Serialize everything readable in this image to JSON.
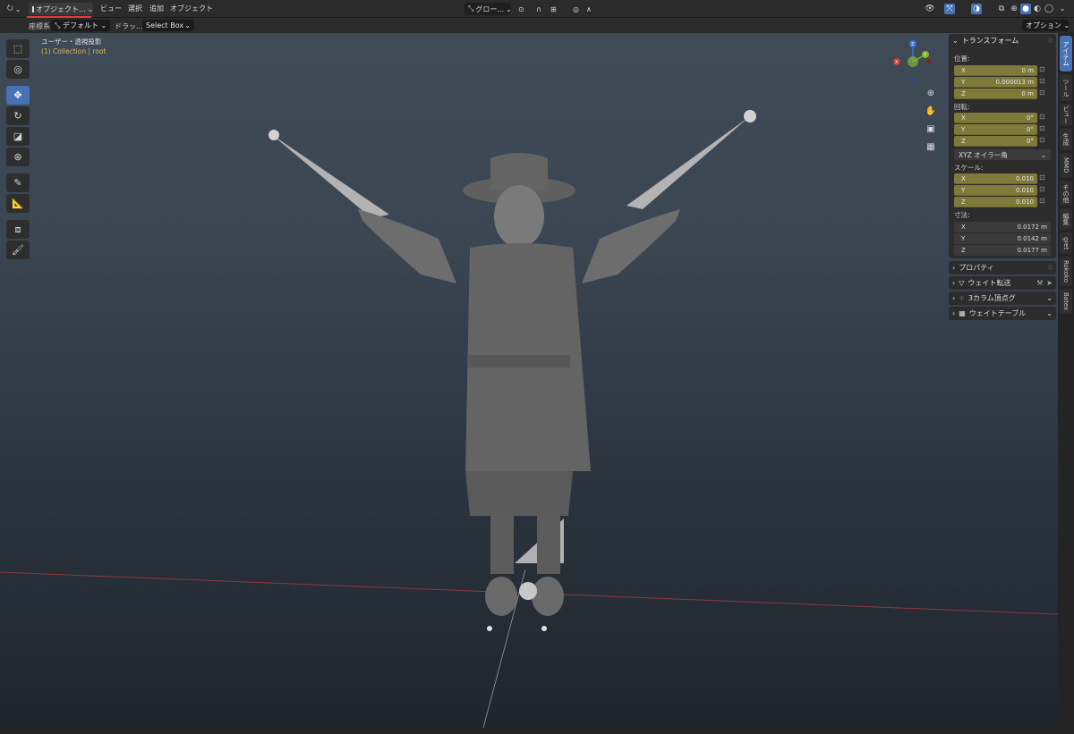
{
  "header": {
    "mode_label": "オブジェクト...",
    "menus": [
      "ビュー",
      "選択",
      "追加",
      "オブジェクト"
    ],
    "orientation_label": "グロー...",
    "options_label": "オプション"
  },
  "subheader": {
    "transform_orientation_label": "座標系:",
    "transform_orientation_value": "デフォルト",
    "drag_label": "ドラッ...",
    "drag_value": "Select Box"
  },
  "viewport": {
    "view_name": "ユーザー・透視投影",
    "collection_info": "(1) Collection | root"
  },
  "tools": [
    "select-box",
    "cursor",
    "move",
    "rotate",
    "scale",
    "transform",
    "annotate",
    "measure",
    "add-cube",
    "brush"
  ],
  "active_tool": "move",
  "gizmo": {
    "x": "X",
    "y": "Y",
    "z": "Z"
  },
  "npanel": {
    "title": "トランスフォーム",
    "location_label": "位置:",
    "location": [
      {
        "axis": "X",
        "value": "0 m"
      },
      {
        "axis": "Y",
        "value": "0.000013 m"
      },
      {
        "axis": "Z",
        "value": "0 m"
      }
    ],
    "rotation_label": "回転:",
    "rotation": [
      {
        "axis": "X",
        "value": "0°"
      },
      {
        "axis": "Y",
        "value": "0°"
      },
      {
        "axis": "Z",
        "value": "0°"
      }
    ],
    "rotation_mode": "XYZ オイラー角",
    "scale_label": "スケール:",
    "scale": [
      {
        "axis": "X",
        "value": "0.010"
      },
      {
        "axis": "Y",
        "value": "0.010"
      },
      {
        "axis": "Z",
        "value": "0.010"
      }
    ],
    "dimensions_label": "寸法:",
    "dimensions": [
      {
        "axis": "X",
        "value": "0.0172 m"
      },
      {
        "axis": "Y",
        "value": "0.0142 m"
      },
      {
        "axis": "Z",
        "value": "0.0177 m"
      }
    ],
    "collapsed_panels": [
      "プロパティ",
      "ウェイト転送",
      "3カラム頂点グ",
      "ウェイトテーブル"
    ]
  },
  "sidebar_tabs": [
    "アイテム",
    "ツール",
    "ビュー",
    "生成",
    "MMD",
    "その他",
    "編集",
    "gret",
    "Rokoko",
    "Batex"
  ],
  "colors": {
    "accent": "#4772b3",
    "animated_field": "#7f7a3a",
    "header": "#2b2b2b",
    "x_axis": "#c8403a",
    "y_axis": "#84b62f",
    "z_axis": "#3a74d0"
  }
}
